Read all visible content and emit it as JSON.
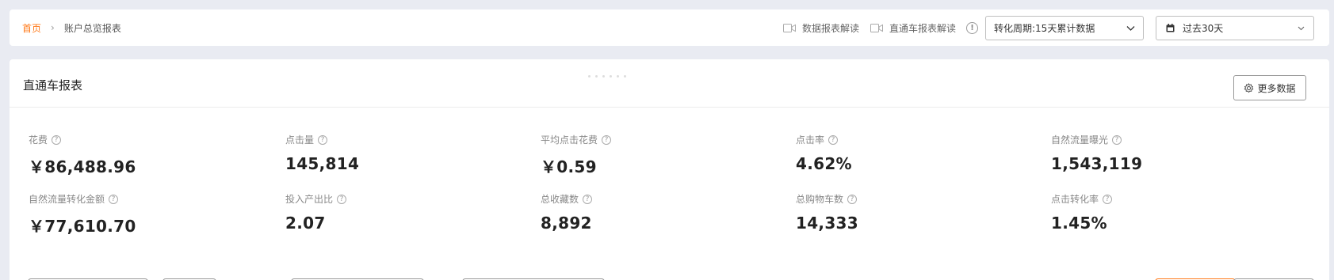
{
  "breadcrumb": {
    "home": "首页",
    "separator": "›",
    "current": "账户总览报表"
  },
  "toolbar": {
    "link1": "数据报表解读",
    "link2": "直通车报表解读",
    "cycle_select": "转化周期:15天累计数据",
    "date_select": "过去30天"
  },
  "card": {
    "title": "直通车报表",
    "more_button": "更多数据"
  },
  "metrics": [
    {
      "label": "花费",
      "value": "￥86,488.96"
    },
    {
      "label": "点击量",
      "value": "145,814"
    },
    {
      "label": "平均点击花费",
      "value": "￥0.59"
    },
    {
      "label": "点击率",
      "value": "4.62%"
    },
    {
      "label": "自然流量曝光",
      "value": "1,543,119"
    },
    {
      "label": "自然流量转化金额",
      "value": "￥77,610.70"
    },
    {
      "label": "投入产出比",
      "value": "2.07"
    },
    {
      "label": "总收藏数",
      "value": "8,892"
    },
    {
      "label": "总购物车数",
      "value": "14,333"
    },
    {
      "label": "点击转化率",
      "value": "1.45%"
    }
  ],
  "colors": {
    "accent": "#ff7a1a",
    "background": "#e9ebf2"
  }
}
